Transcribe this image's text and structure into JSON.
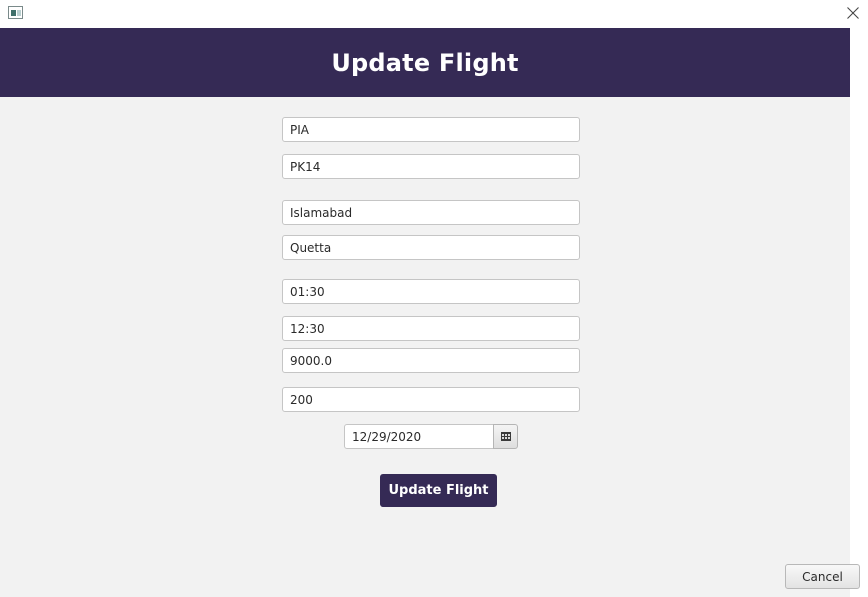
{
  "window": {
    "close_glyph": "✕"
  },
  "header": {
    "title": "Update Flight"
  },
  "form": {
    "airline": "PIA",
    "flight_no": "PK14",
    "origin": "Islamabad",
    "destination": "Quetta",
    "departure_time": "01:30",
    "arrival_time": "12:30",
    "fare": "9000.0",
    "seats": "200",
    "date": "12/29/2020"
  },
  "actions": {
    "update_label": "Update Flight",
    "cancel_label": "Cancel"
  },
  "colors": {
    "accent": "#352a55",
    "background": "#f2f2f2"
  }
}
